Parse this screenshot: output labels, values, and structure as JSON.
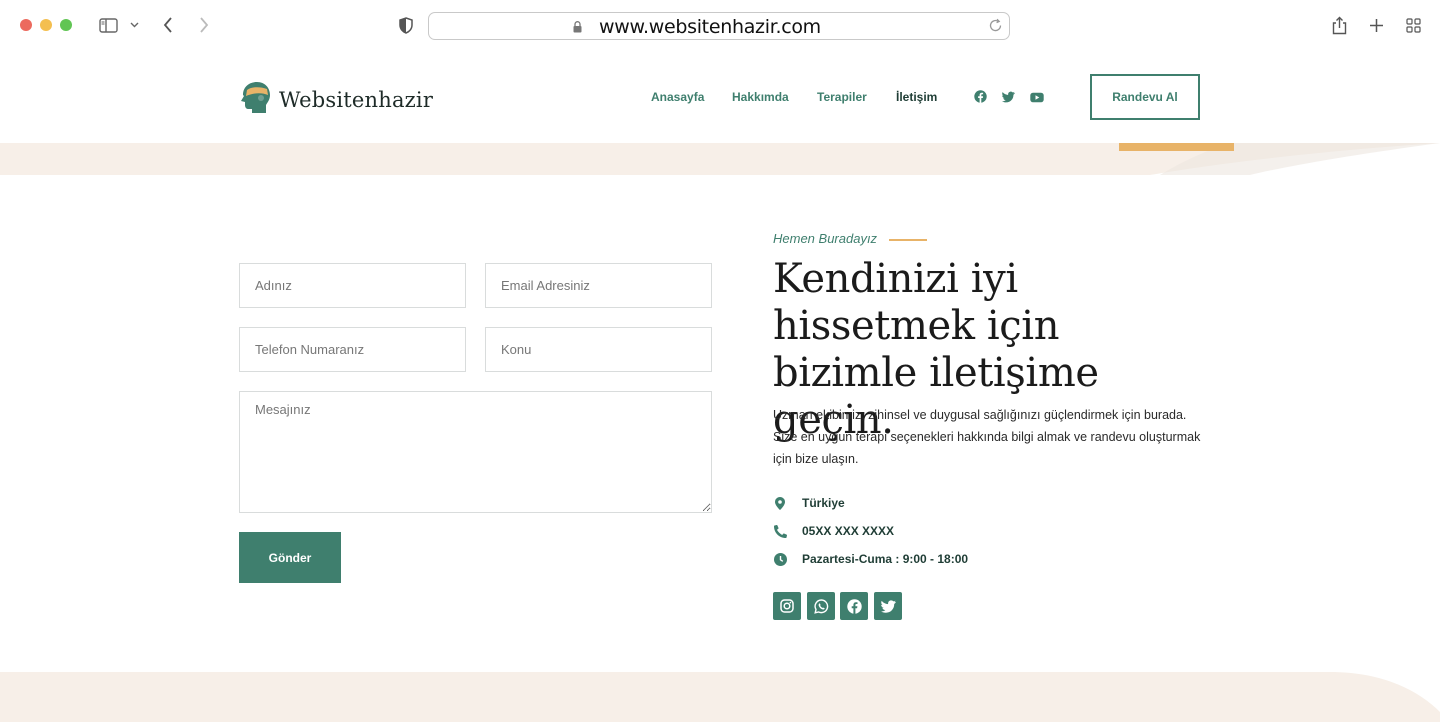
{
  "browser": {
    "url": "www.websitenhazir.com"
  },
  "header": {
    "brand": "Websitenhazir",
    "nav": [
      {
        "label": "Anasayfa"
      },
      {
        "label": "Hakkımda"
      },
      {
        "label": "Terapiler"
      },
      {
        "label": "İletişim",
        "active": true
      }
    ],
    "social_icons": [
      "facebook-icon",
      "twitter-icon",
      "youtube-icon"
    ],
    "cta_label": "Randevu Al"
  },
  "form": {
    "name_placeholder": "Adınız",
    "email_placeholder": "Email Adresiniz",
    "phone_placeholder": "Telefon Numaranız",
    "subject_placeholder": "Konu",
    "message_placeholder": "Mesajınız",
    "submit_label": "Gönder"
  },
  "contact": {
    "eyebrow": "Hemen Buradayız",
    "headline": "Kendinizi iyi hissetmek için bizimle iletişime geçin.",
    "intro": "Uzman ekibimiz, zihinsel ve duygusal sağlığınızı güçlendirmek için burada. Size en uygun terapi seçenekleri hakkında bilgi almak ve randevu oluşturmak için bize ulaşın.",
    "location": "Türkiye",
    "phone": "05XX XXX XXXX",
    "hours": "Pazartesi-Cuma : 9:00 - 18:00",
    "social_icons": [
      "instagram-icon",
      "whatsapp-icon",
      "facebook-icon",
      "twitter-icon"
    ]
  },
  "colors": {
    "primary": "#3f7f6e",
    "accent": "#e8b368",
    "beige": "#f7efe8"
  }
}
